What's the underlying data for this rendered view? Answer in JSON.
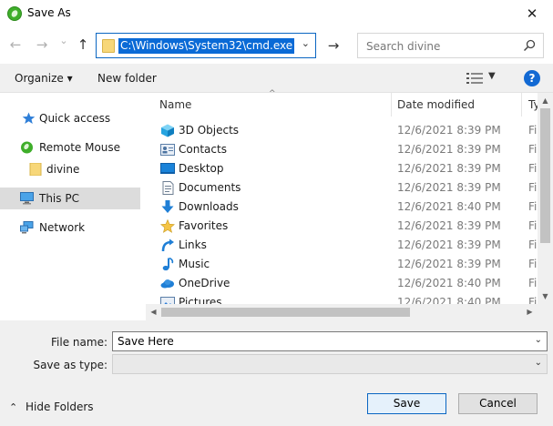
{
  "window": {
    "title": "Save As",
    "close_glyph": "✕",
    "app_icon": "remote-mouse-icon"
  },
  "address": {
    "back_glyph": "←",
    "forward_glyph": "→",
    "recent_glyph": "⌄",
    "up_glyph": "↑",
    "path": "C:\\Windows\\System32\\cmd.exe",
    "dropdown_glyph": "⌄",
    "go_glyph": "→"
  },
  "search": {
    "placeholder": "Search divine"
  },
  "toolbar": {
    "organize_label": "Organize ▾",
    "new_folder_label": "New folder",
    "view_dropdown_glyph": "▼",
    "help_glyph": "?"
  },
  "nav": {
    "items": [
      {
        "label": "Quick access",
        "icon": "star-pin-icon"
      },
      {
        "label": "Remote Mouse",
        "icon": "remote-mouse-icon"
      },
      {
        "label": "divine",
        "icon": "folder-icon"
      },
      {
        "label": "This PC",
        "icon": "computer-icon"
      },
      {
        "label": "Network",
        "icon": "network-icon"
      }
    ]
  },
  "columns": {
    "name": "Name",
    "date": "Date modified",
    "type": "Ty"
  },
  "files": [
    {
      "name": "3D Objects",
      "date": "12/6/2021 8:39 PM",
      "type": "Fi",
      "icon": "cube-3d-icon"
    },
    {
      "name": "Contacts",
      "date": "12/6/2021 8:39 PM",
      "type": "Fi",
      "icon": "contact-card-icon"
    },
    {
      "name": "Desktop",
      "date": "12/6/2021 8:39 PM",
      "type": "Fi",
      "icon": "desktop-icon"
    },
    {
      "name": "Documents",
      "date": "12/6/2021 8:39 PM",
      "type": "Fi",
      "icon": "document-icon"
    },
    {
      "name": "Downloads",
      "date": "12/6/2021 8:40 PM",
      "type": "Fi",
      "icon": "download-arrow-icon"
    },
    {
      "name": "Favorites",
      "date": "12/6/2021 8:39 PM",
      "type": "Fi",
      "icon": "star-icon"
    },
    {
      "name": "Links",
      "date": "12/6/2021 8:39 PM",
      "type": "Fi",
      "icon": "link-arrow-icon"
    },
    {
      "name": "Music",
      "date": "12/6/2021 8:39 PM",
      "type": "Fi",
      "icon": "music-note-icon"
    },
    {
      "name": "OneDrive",
      "date": "12/6/2021 8:40 PM",
      "type": "Fi",
      "icon": "cloud-icon"
    },
    {
      "name": "Pictures",
      "date": "12/6/2021 8:40 PM",
      "type": "Fi",
      "icon": "picture-icon"
    }
  ],
  "form": {
    "file_name_label": "File name:",
    "file_name_value": "Save Here",
    "save_type_label": "Save as type:",
    "save_type_value": "",
    "dropdown_glyph": "⌄"
  },
  "footer": {
    "hide_folders_label": "Hide Folders",
    "hide_glyph": "⌃",
    "save_label": "Save",
    "cancel_label": "Cancel"
  },
  "colors": {
    "accent": "#0a66c2",
    "selection": "#0a6ad6",
    "folder": "#f7d779"
  }
}
